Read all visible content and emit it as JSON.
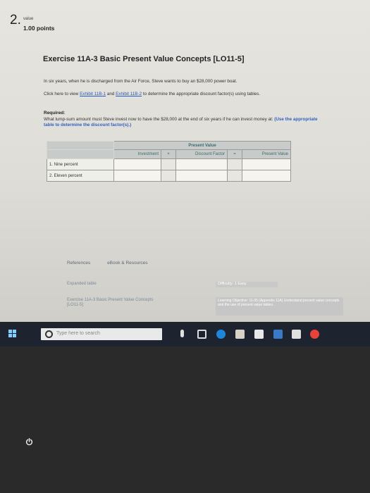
{
  "question": {
    "number": "2.",
    "value_label": "value",
    "points": "1.00 points"
  },
  "exercise": {
    "title": "Exercise 11A-3 Basic Present Value Concepts [LO11-5]",
    "scenario": "In six years, when he is discharged from the Air Force, Steve wants to buy an $28,000 power boat.",
    "click_prefix": "Click here to view",
    "exhibit1": "Exhibit 11B-1",
    "and_word": "and",
    "exhibit2": "Exhibit 11B-2",
    "click_suffix": "to determine the appropriate discount factor(s) using tables.",
    "required_label": "Required:",
    "required_text": "What lump-sum amount must Steve invest now to have the $28,000 at the end of six years if he can invest money at:",
    "required_hint": "(Use the appropriate table to determine the discount factor(s).)"
  },
  "table": {
    "group_header": "Present Value",
    "col_investment": "Investment",
    "col_discount": "Discount Factor",
    "col_present": "Present Value",
    "op_multiply": "×",
    "op_equals": "=",
    "rows": [
      {
        "label": "1. Nine percent"
      },
      {
        "label": "2. Eleven percent"
      }
    ]
  },
  "tabs": {
    "references": "References",
    "ebook": "eBook & Resources"
  },
  "footer": {
    "expanded_table": "Expanded table",
    "exercise_ref": "Exercise 11A-3 Basic Present Value Concepts [LO11-5]",
    "difficulty": "Difficulty: 1 Easy",
    "learning": "Learning Objective: 11-05 (Appendix 11A) Understand present value concepts and the use of present value tables."
  },
  "taskbar": {
    "search_placeholder": "Type here to search"
  }
}
